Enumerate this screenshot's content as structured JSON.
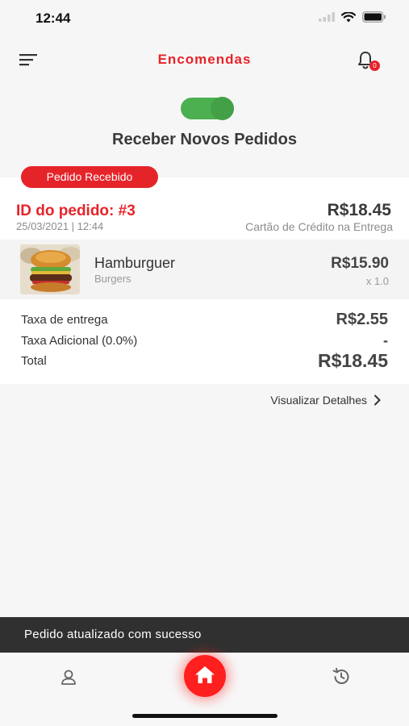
{
  "status_bar": {
    "time": "12:44"
  },
  "header": {
    "title": "Encomendas",
    "notification_count": "0"
  },
  "toggle": {
    "label": "Receber Novos Pedidos",
    "state": "on"
  },
  "order": {
    "status": "Pedido Recebido",
    "id_label": "ID do pedido: #3",
    "date": "25/03/2021 | 12:44",
    "total": "R$18.45",
    "payment_method": "Cartão de Crédito na Entrega",
    "items": [
      {
        "name": "Hamburguer",
        "category": "Burgers",
        "price": "R$15.90",
        "quantity": "x 1.0"
      }
    ],
    "fees": [
      {
        "label": "Taxa de entrega",
        "value": "R$2.55"
      },
      {
        "label": "Taxa Adicional (0.0%)",
        "value": "-"
      },
      {
        "label": "Total",
        "value": "R$18.45"
      }
    ],
    "details_link": "Visualizar Detalhes"
  },
  "snackbar": {
    "message": "Pedido atualizado com sucesso"
  },
  "tabs": [
    {
      "icon": "user-icon"
    },
    {
      "icon": "home-icon",
      "active": true
    },
    {
      "icon": "history-icon"
    }
  ],
  "colors": {
    "accent": "#e5242a",
    "toggle": "#4caf50",
    "snackbar": "#303030"
  }
}
